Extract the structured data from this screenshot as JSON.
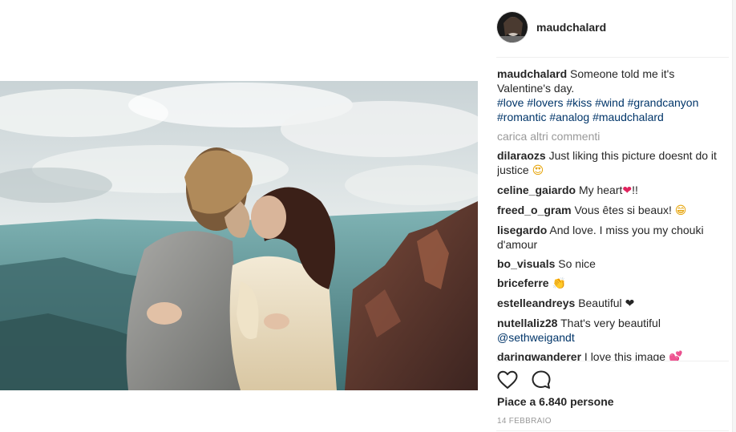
{
  "post": {
    "username": "maudchalard",
    "caption_text": "Someone told me it's Valentine's day.",
    "hashtags": "#love #lovers #kiss #wind #grandcanyon #romantic #analog #maudchalard",
    "load_more": "carica altri commenti"
  },
  "comments": [
    {
      "user": "dilaraozs",
      "text": "Just liking this picture doesnt do it justice",
      "emoji": "😍"
    },
    {
      "user": "celine_gaiardo",
      "text": "My heart",
      "emoji": "❤",
      "suffix": "!!"
    },
    {
      "user": "freed_o_gram",
      "text": "Vous êtes si beaux!",
      "emoji": "😁"
    },
    {
      "user": "lisegardo",
      "text": "And love. I miss you my chouki d'amour"
    },
    {
      "user": "bo_visuals",
      "text": "So nice"
    },
    {
      "user": "briceferre",
      "text": "",
      "emoji": "👏"
    },
    {
      "user": "estelleandreys",
      "text": "Beautiful",
      "emoji": "❤"
    },
    {
      "user": "nutellaliz28",
      "text": "That's very beautiful",
      "mention": "@sethweigandt"
    },
    {
      "user": "daringwanderer",
      "text": "I love this image",
      "emoji": "💕"
    }
  ],
  "actions": {
    "like_icon": "heart-outline-icon",
    "comment_icon": "comment-bubble-icon"
  },
  "likes_text": "Piace a 6.840 persone",
  "date_text": "14 FEBBRAIO",
  "colors": {
    "text": "#262626",
    "link": "#003569",
    "muted": "#999999",
    "divider": "#efefef"
  }
}
